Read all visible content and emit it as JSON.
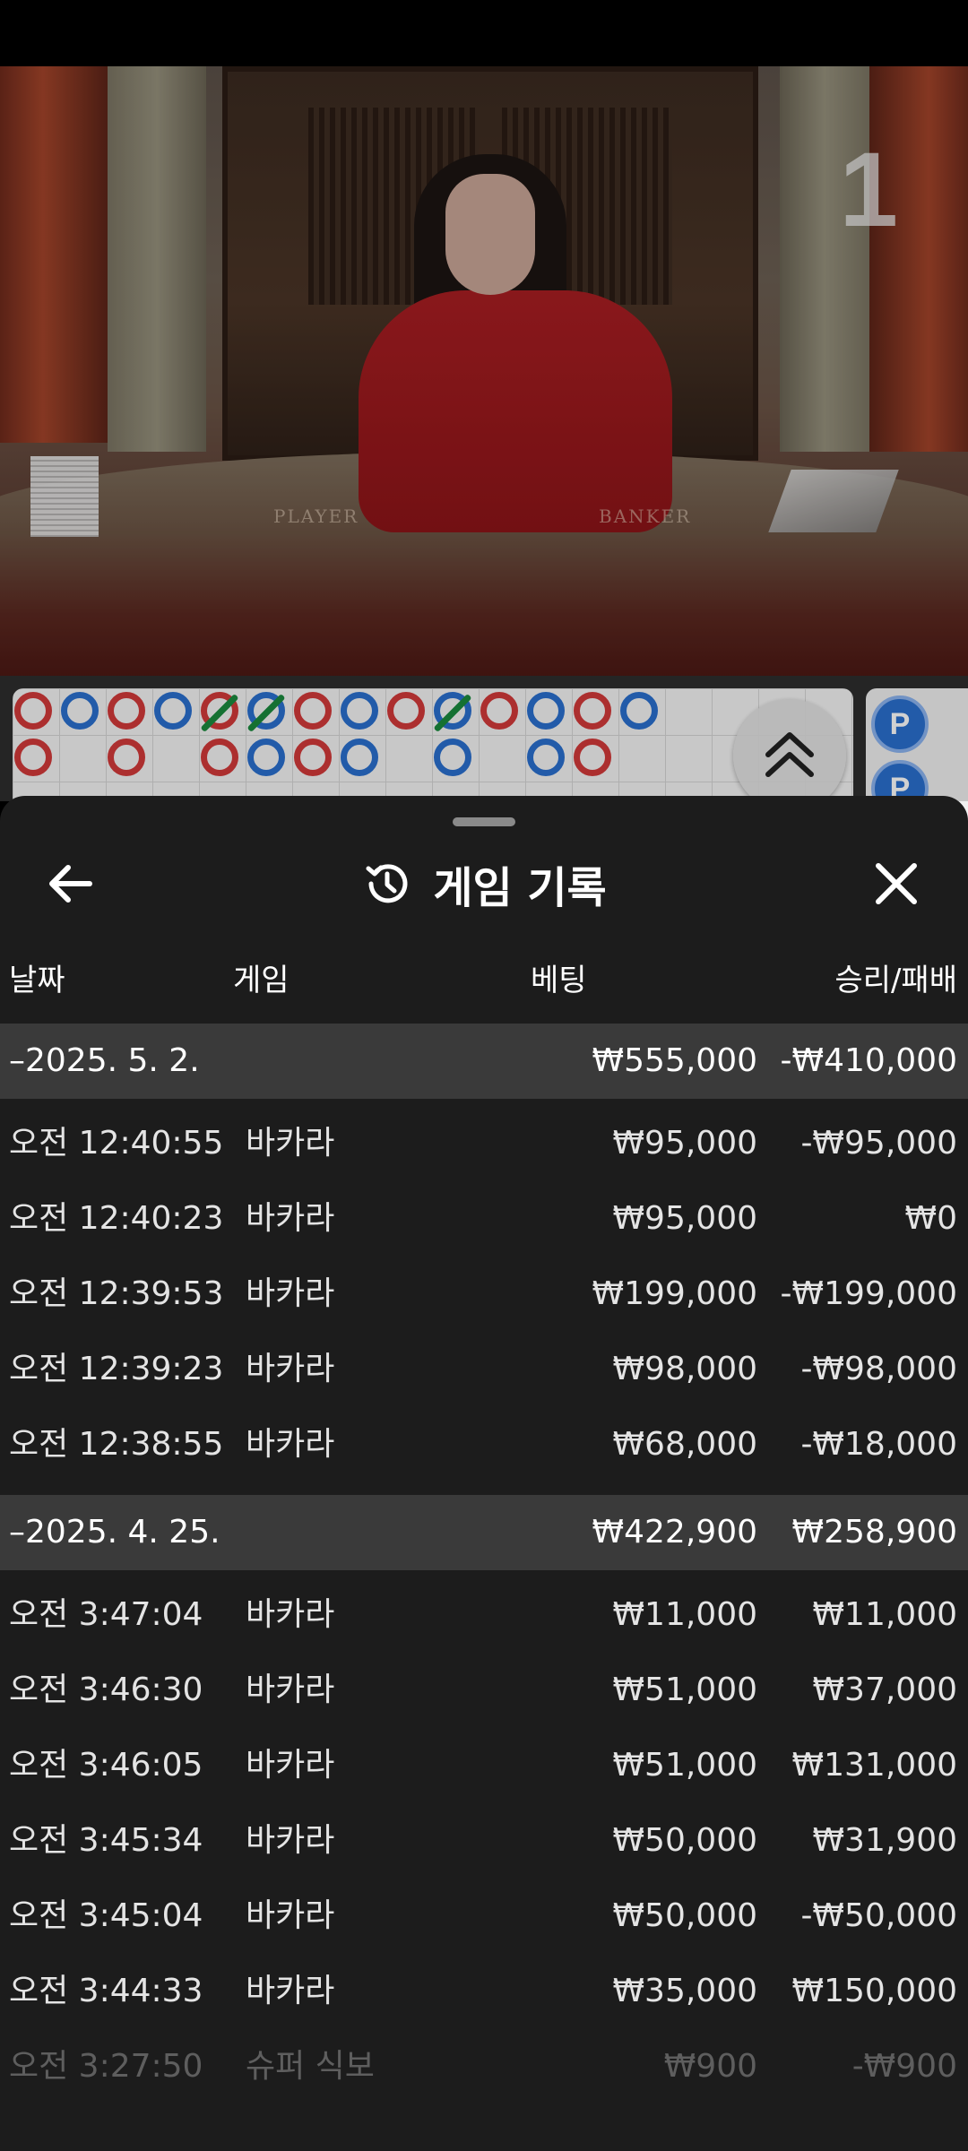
{
  "video": {
    "table_number": "1",
    "table_labels": {
      "player": "PLAYER",
      "banker": "BANKER"
    }
  },
  "roadmap": {
    "bead_road": [
      "P",
      "P"
    ]
  },
  "history": {
    "title": "게임 기록",
    "columns": {
      "date": "날짜",
      "game": "게임",
      "bet": "베팅",
      "result": "승리/패배"
    },
    "groups": [
      {
        "date": "–2025. 5. 2.",
        "total_bet": "₩555,000",
        "total_result": "-₩410,000",
        "entries": [
          {
            "time": "오전 12:40:55",
            "game": "바카라",
            "bet": "₩95,000",
            "result": "-₩95,000"
          },
          {
            "time": "오전 12:40:23",
            "game": "바카라",
            "bet": "₩95,000",
            "result": "₩0"
          },
          {
            "time": "오전 12:39:53",
            "game": "바카라",
            "bet": "₩199,000",
            "result": "-₩199,000"
          },
          {
            "time": "오전 12:39:23",
            "game": "바카라",
            "bet": "₩98,000",
            "result": "-₩98,000"
          },
          {
            "time": "오전 12:38:55",
            "game": "바카라",
            "bet": "₩68,000",
            "result": "-₩18,000"
          }
        ]
      },
      {
        "date": "–2025. 4. 25.",
        "total_bet": "₩422,900",
        "total_result": "₩258,900",
        "entries": [
          {
            "time": "오전 3:47:04",
            "game": "바카라",
            "bet": "₩11,000",
            "result": "₩11,000"
          },
          {
            "time": "오전 3:46:30",
            "game": "바카라",
            "bet": "₩51,000",
            "result": "₩37,000"
          },
          {
            "time": "오전 3:46:05",
            "game": "바카라",
            "bet": "₩51,000",
            "result": "₩131,000"
          },
          {
            "time": "오전 3:45:34",
            "game": "바카라",
            "bet": "₩50,000",
            "result": "₩31,900"
          },
          {
            "time": "오전 3:45:04",
            "game": "바카라",
            "bet": "₩50,000",
            "result": "-₩50,000"
          },
          {
            "time": "오전 3:44:33",
            "game": "바카라",
            "bet": "₩35,000",
            "result": "₩150,000"
          },
          {
            "time": "오전 3:27:50",
            "game": "슈퍼 식보",
            "bet": "₩900",
            "result": "-₩900"
          }
        ]
      }
    ]
  }
}
